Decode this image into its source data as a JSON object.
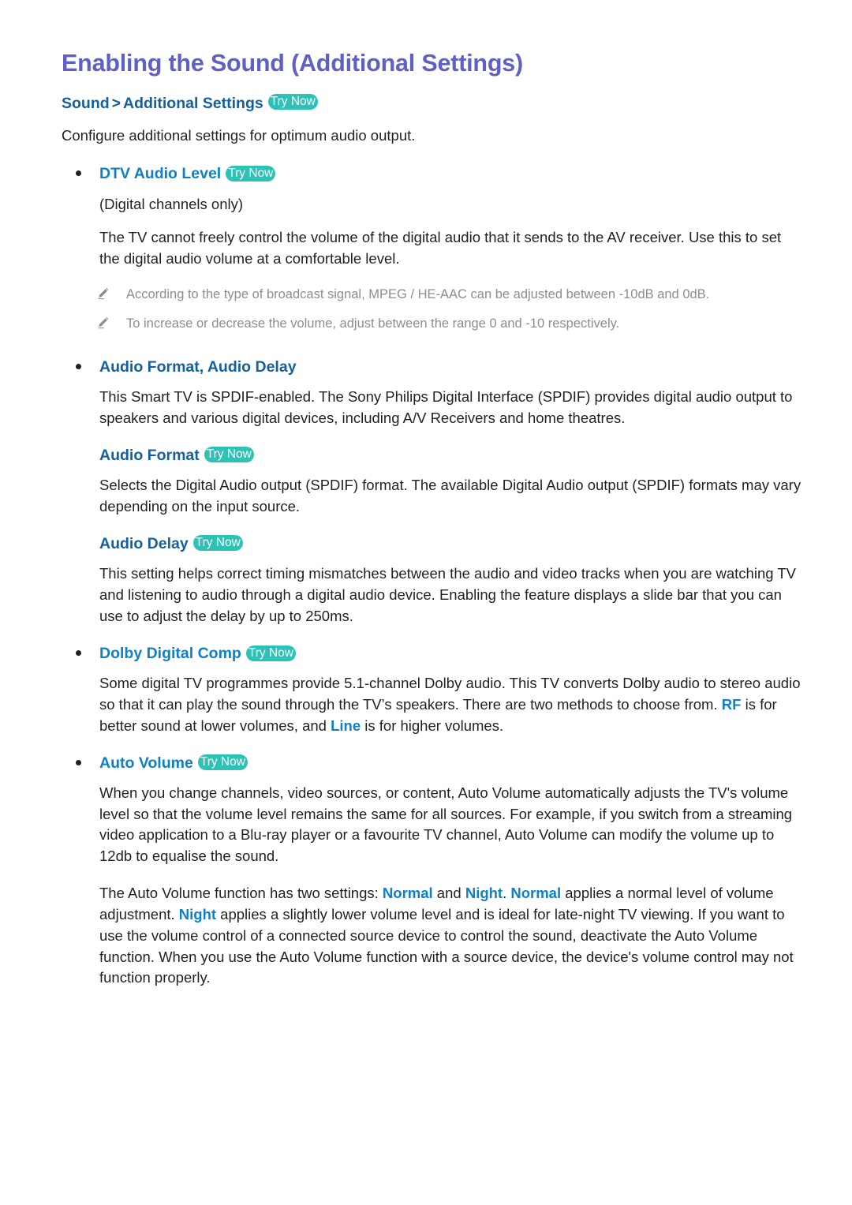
{
  "colors": {
    "title": "#5f5fc4",
    "link_bright": "#0e80c8",
    "link_deep": "#14609f",
    "try_now_bg": "#2cc2b6",
    "body_text": "#231f20",
    "note_text": "#8d8d8d"
  },
  "title": "Enabling the Sound (Additional Settings)",
  "breadcrumb": {
    "root": "Sound",
    "separator": ">",
    "leaf": "Additional Settings",
    "try_now": "Try Now"
  },
  "intro": "Configure additional settings for optimum audio output.",
  "sections": [
    {
      "heading": "DTV Audio Level",
      "try_now": "Try Now",
      "sub_note": "(Digital channels only)",
      "paragraph": "The TV cannot freely control the volume of the digital audio that it sends to the AV receiver. Use this to set the digital audio volume at a comfortable level.",
      "notes": [
        "According to the type of broadcast signal, MPEG / HE-AAC can be adjusted between -10dB and 0dB.",
        "To increase or decrease the volume, adjust between the range 0 and -10 respectively."
      ]
    },
    {
      "heading": "Audio Format, Audio Delay",
      "paragraph": "This Smart TV is SPDIF-enabled. The Sony Philips Digital Interface (SPDIF) provides digital audio output to speakers and various digital devices, including A/V Receivers and home theatres.",
      "subsections": [
        {
          "heading": "Audio Format",
          "try_now": "Try Now",
          "paragraph": "Selects the Digital Audio output (SPDIF) format. The available Digital Audio output (SPDIF) formats may vary depending on the input source."
        },
        {
          "heading": "Audio Delay",
          "try_now": "Try Now",
          "paragraph": "This setting helps correct timing mismatches between the audio and video tracks when you are watching TV and listening to audio through a digital audio device. Enabling the feature displays a slide bar that you can use to adjust the delay by up to 250ms."
        }
      ]
    },
    {
      "heading": "Dolby Digital Comp",
      "try_now": "Try Now",
      "paragraph_parts": {
        "p1": "Some digital TV programmes provide 5.1-channel Dolby audio. This TV converts Dolby audio to stereo audio so that it can play the sound through the TV’s speakers. There are two methods to choose from. ",
        "kw1": "RF",
        "p2": " is for better sound at lower volumes, and ",
        "kw2": "Line",
        "p3": " is for higher volumes."
      }
    },
    {
      "heading": "Auto Volume",
      "try_now": "Try Now",
      "paragraph": "When you change channels, video sources, or content, Auto Volume automatically adjusts the TV's volume level so that the volume level remains the same for all sources. For example, if you switch from a streaming video application to a Blu-ray player or a favourite TV channel, Auto Volume can modify the volume up to 12db to equalise the sound.",
      "paragraph2_parts": {
        "p1": "The Auto Volume function has two settings: ",
        "kw1": "Normal",
        "p2": " and ",
        "kw2": "Night",
        "p3": ". ",
        "kw3": "Normal",
        "p4": " applies a normal level of volume adjustment. ",
        "kw4": "Night",
        "p5": " applies a slightly lower volume level and is ideal for late-night TV viewing. If you want to use the volume control of a connected source device to control the sound, deactivate the Auto Volume function. When you use the Auto Volume function with a source device, the device's volume control may not function properly."
      }
    }
  ],
  "icons": {
    "note": "pencil-icon"
  }
}
